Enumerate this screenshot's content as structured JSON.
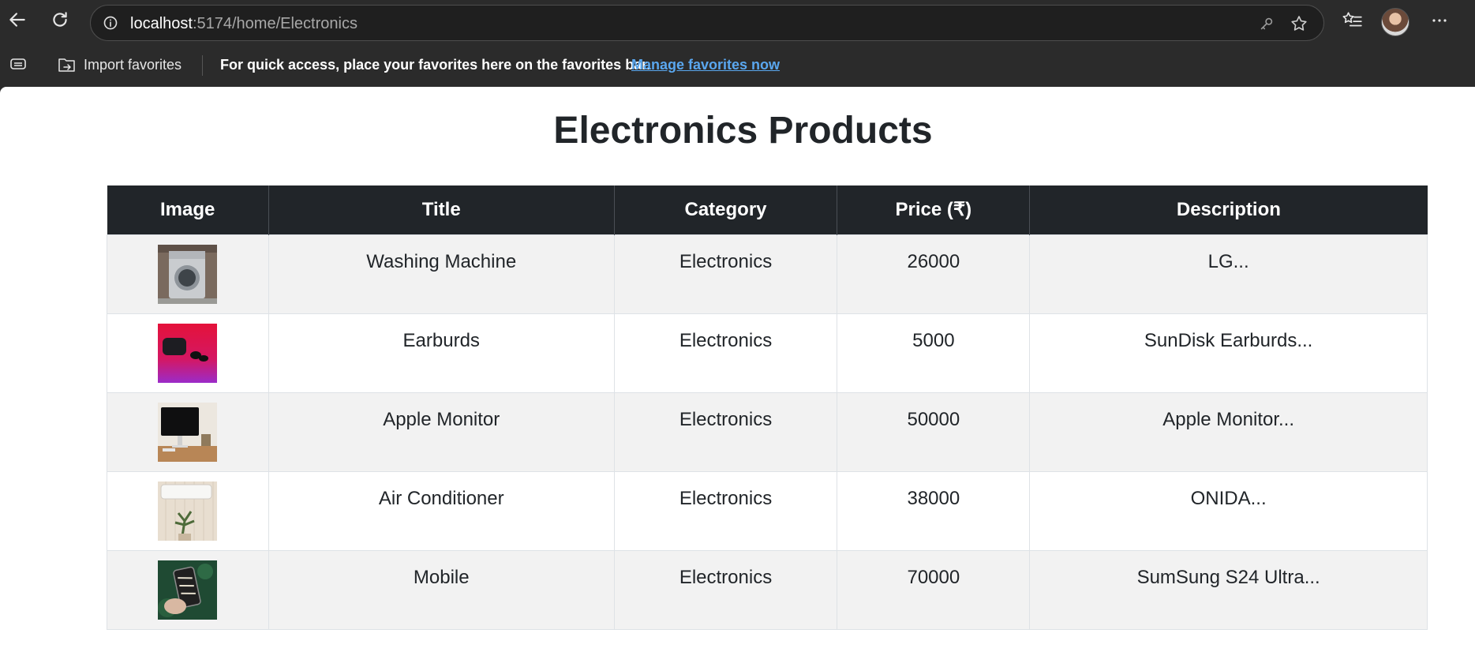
{
  "browser": {
    "url_host": "localhost",
    "url_rest": ":5174/home/Electronics",
    "favorites_bar": {
      "import_label": "Import favorites",
      "message": "For quick access, place your favorites here on the favorites bar.",
      "manage_link": "Manage favorites now"
    }
  },
  "page": {
    "title": "Electronics Products",
    "table": {
      "headers": [
        "Image",
        "Title",
        "Category",
        "Price (₹)",
        "Description"
      ],
      "rows": [
        {
          "image": "washing-machine-photo",
          "title": "Washing Machine",
          "category": "Electronics",
          "price": "26000",
          "description": "LG..."
        },
        {
          "image": "earbuds-photo",
          "title": "Earburds",
          "category": "Electronics",
          "price": "5000",
          "description": "SunDisk Earburds..."
        },
        {
          "image": "apple-monitor-photo",
          "title": "Apple Monitor",
          "category": "Electronics",
          "price": "50000",
          "description": "Apple Monitor..."
        },
        {
          "image": "air-conditioner-photo",
          "title": "Air Conditioner",
          "category": "Electronics",
          "price": "38000",
          "description": "ONIDA..."
        },
        {
          "image": "mobile-photo",
          "title": "Mobile",
          "category": "Electronics",
          "price": "70000",
          "description": "SumSung S24 Ultra..."
        }
      ]
    }
  },
  "colors": {
    "chrome_bg": "#2b2b2b",
    "table_header_bg": "#212529",
    "table_stripe_bg": "#f2f2f2",
    "link": "#5aa7ef"
  }
}
